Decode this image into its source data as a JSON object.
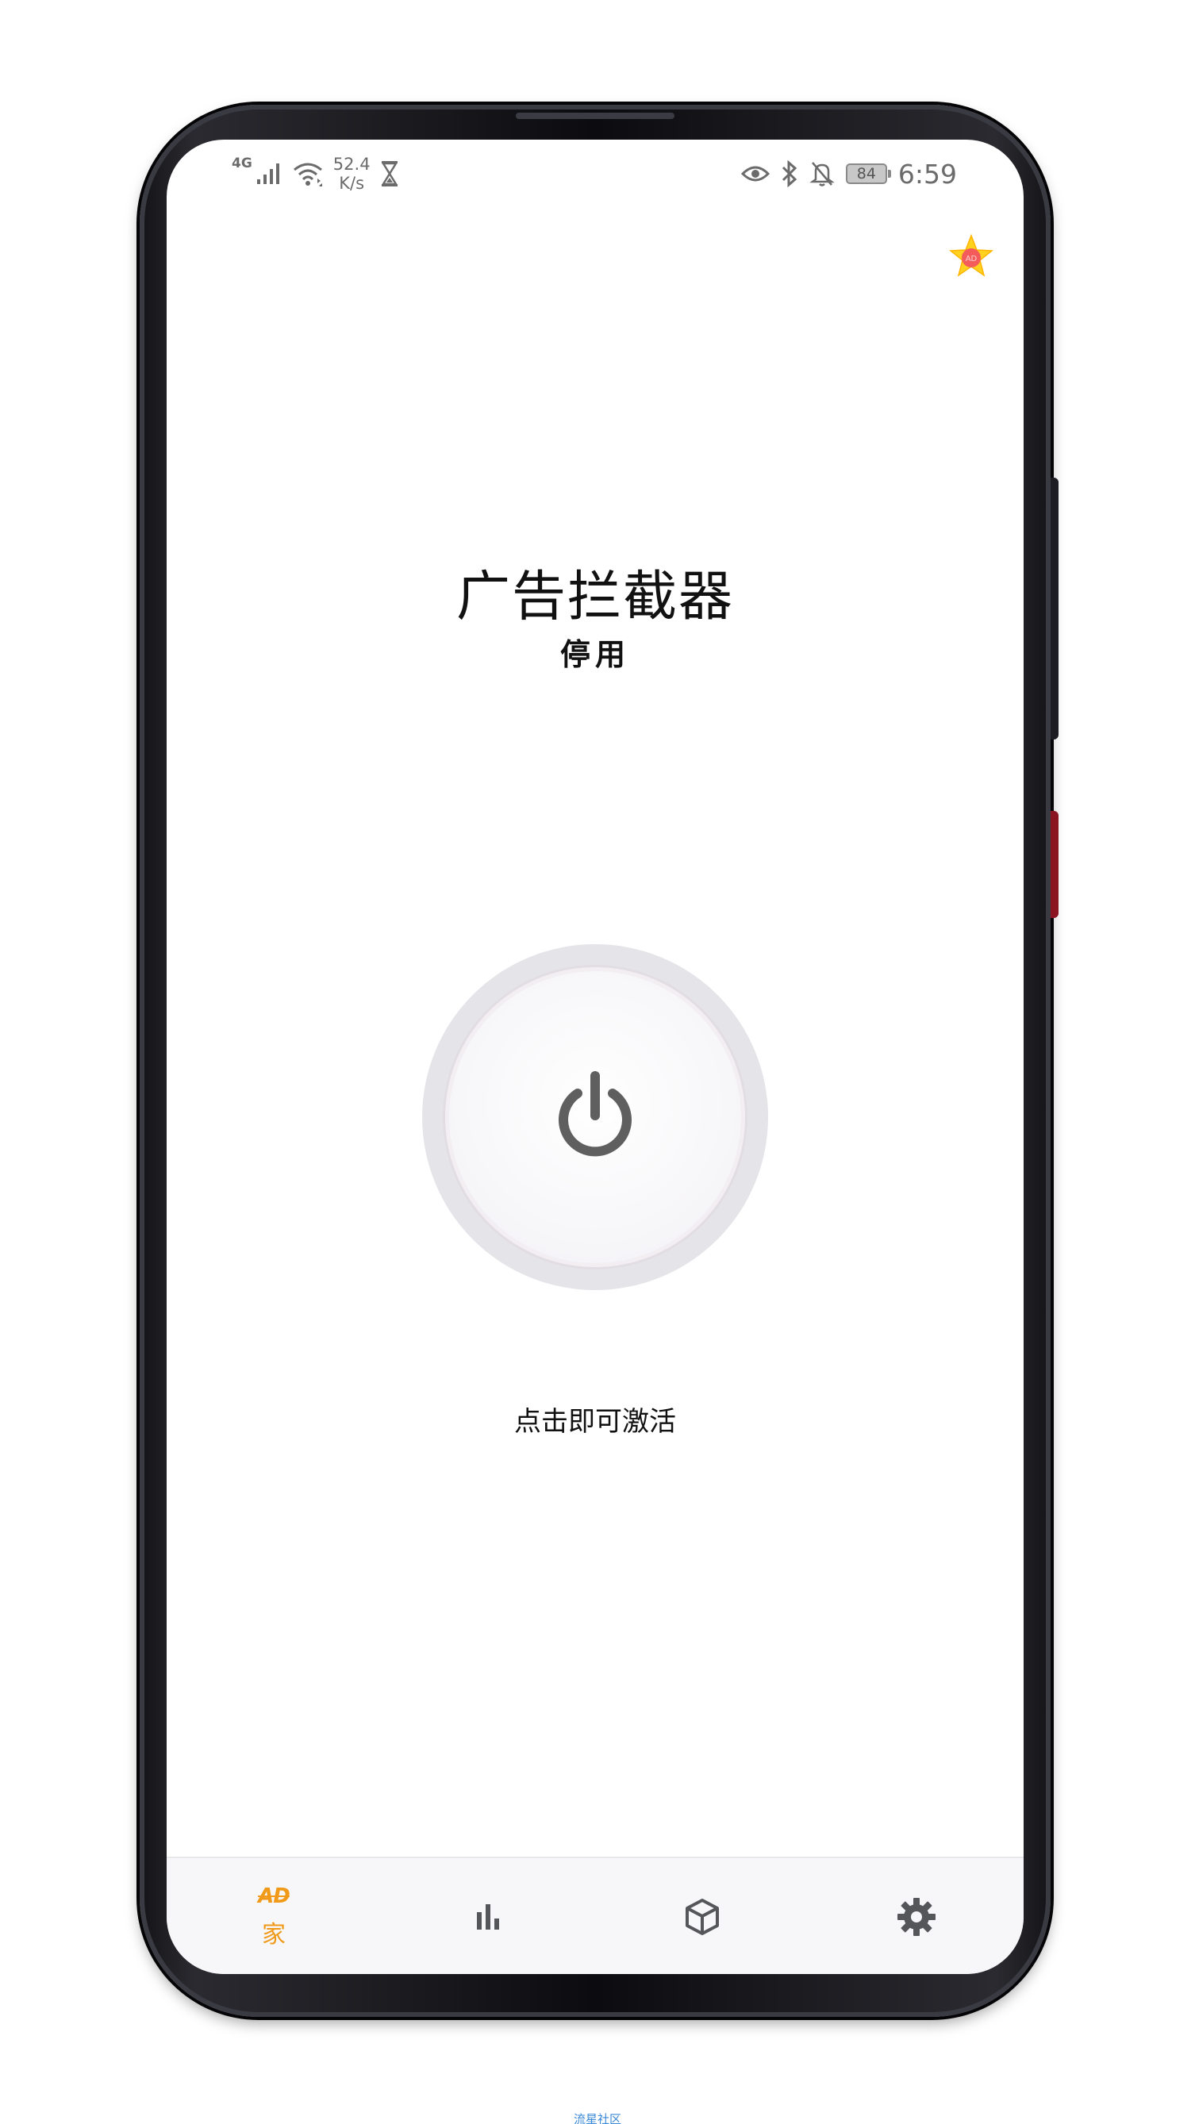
{
  "status_bar": {
    "network_type": "4G",
    "speed_value": "52.4",
    "speed_unit": "K/s",
    "battery": "84",
    "time": "6:59"
  },
  "main": {
    "title": "广告拦截器",
    "status": "停用",
    "hint": "点击即可激活",
    "power_state": "off"
  },
  "bottom_nav": {
    "items": [
      {
        "id": "home",
        "icon": "ad-icon",
        "icon_text": "AD",
        "label": "家",
        "active": true
      },
      {
        "id": "stats",
        "icon": "bar-chart-icon",
        "label": "",
        "active": false
      },
      {
        "id": "packages",
        "icon": "box-icon",
        "label": "",
        "active": false
      },
      {
        "id": "settings",
        "icon": "gear-icon",
        "label": "",
        "active": false
      }
    ]
  },
  "colors": {
    "accent": "#f19a1a",
    "nav_icon": "#55565a",
    "power_icon": "#5f5f5f",
    "ring": "#e5e4e8"
  },
  "watermark": "流星社区"
}
